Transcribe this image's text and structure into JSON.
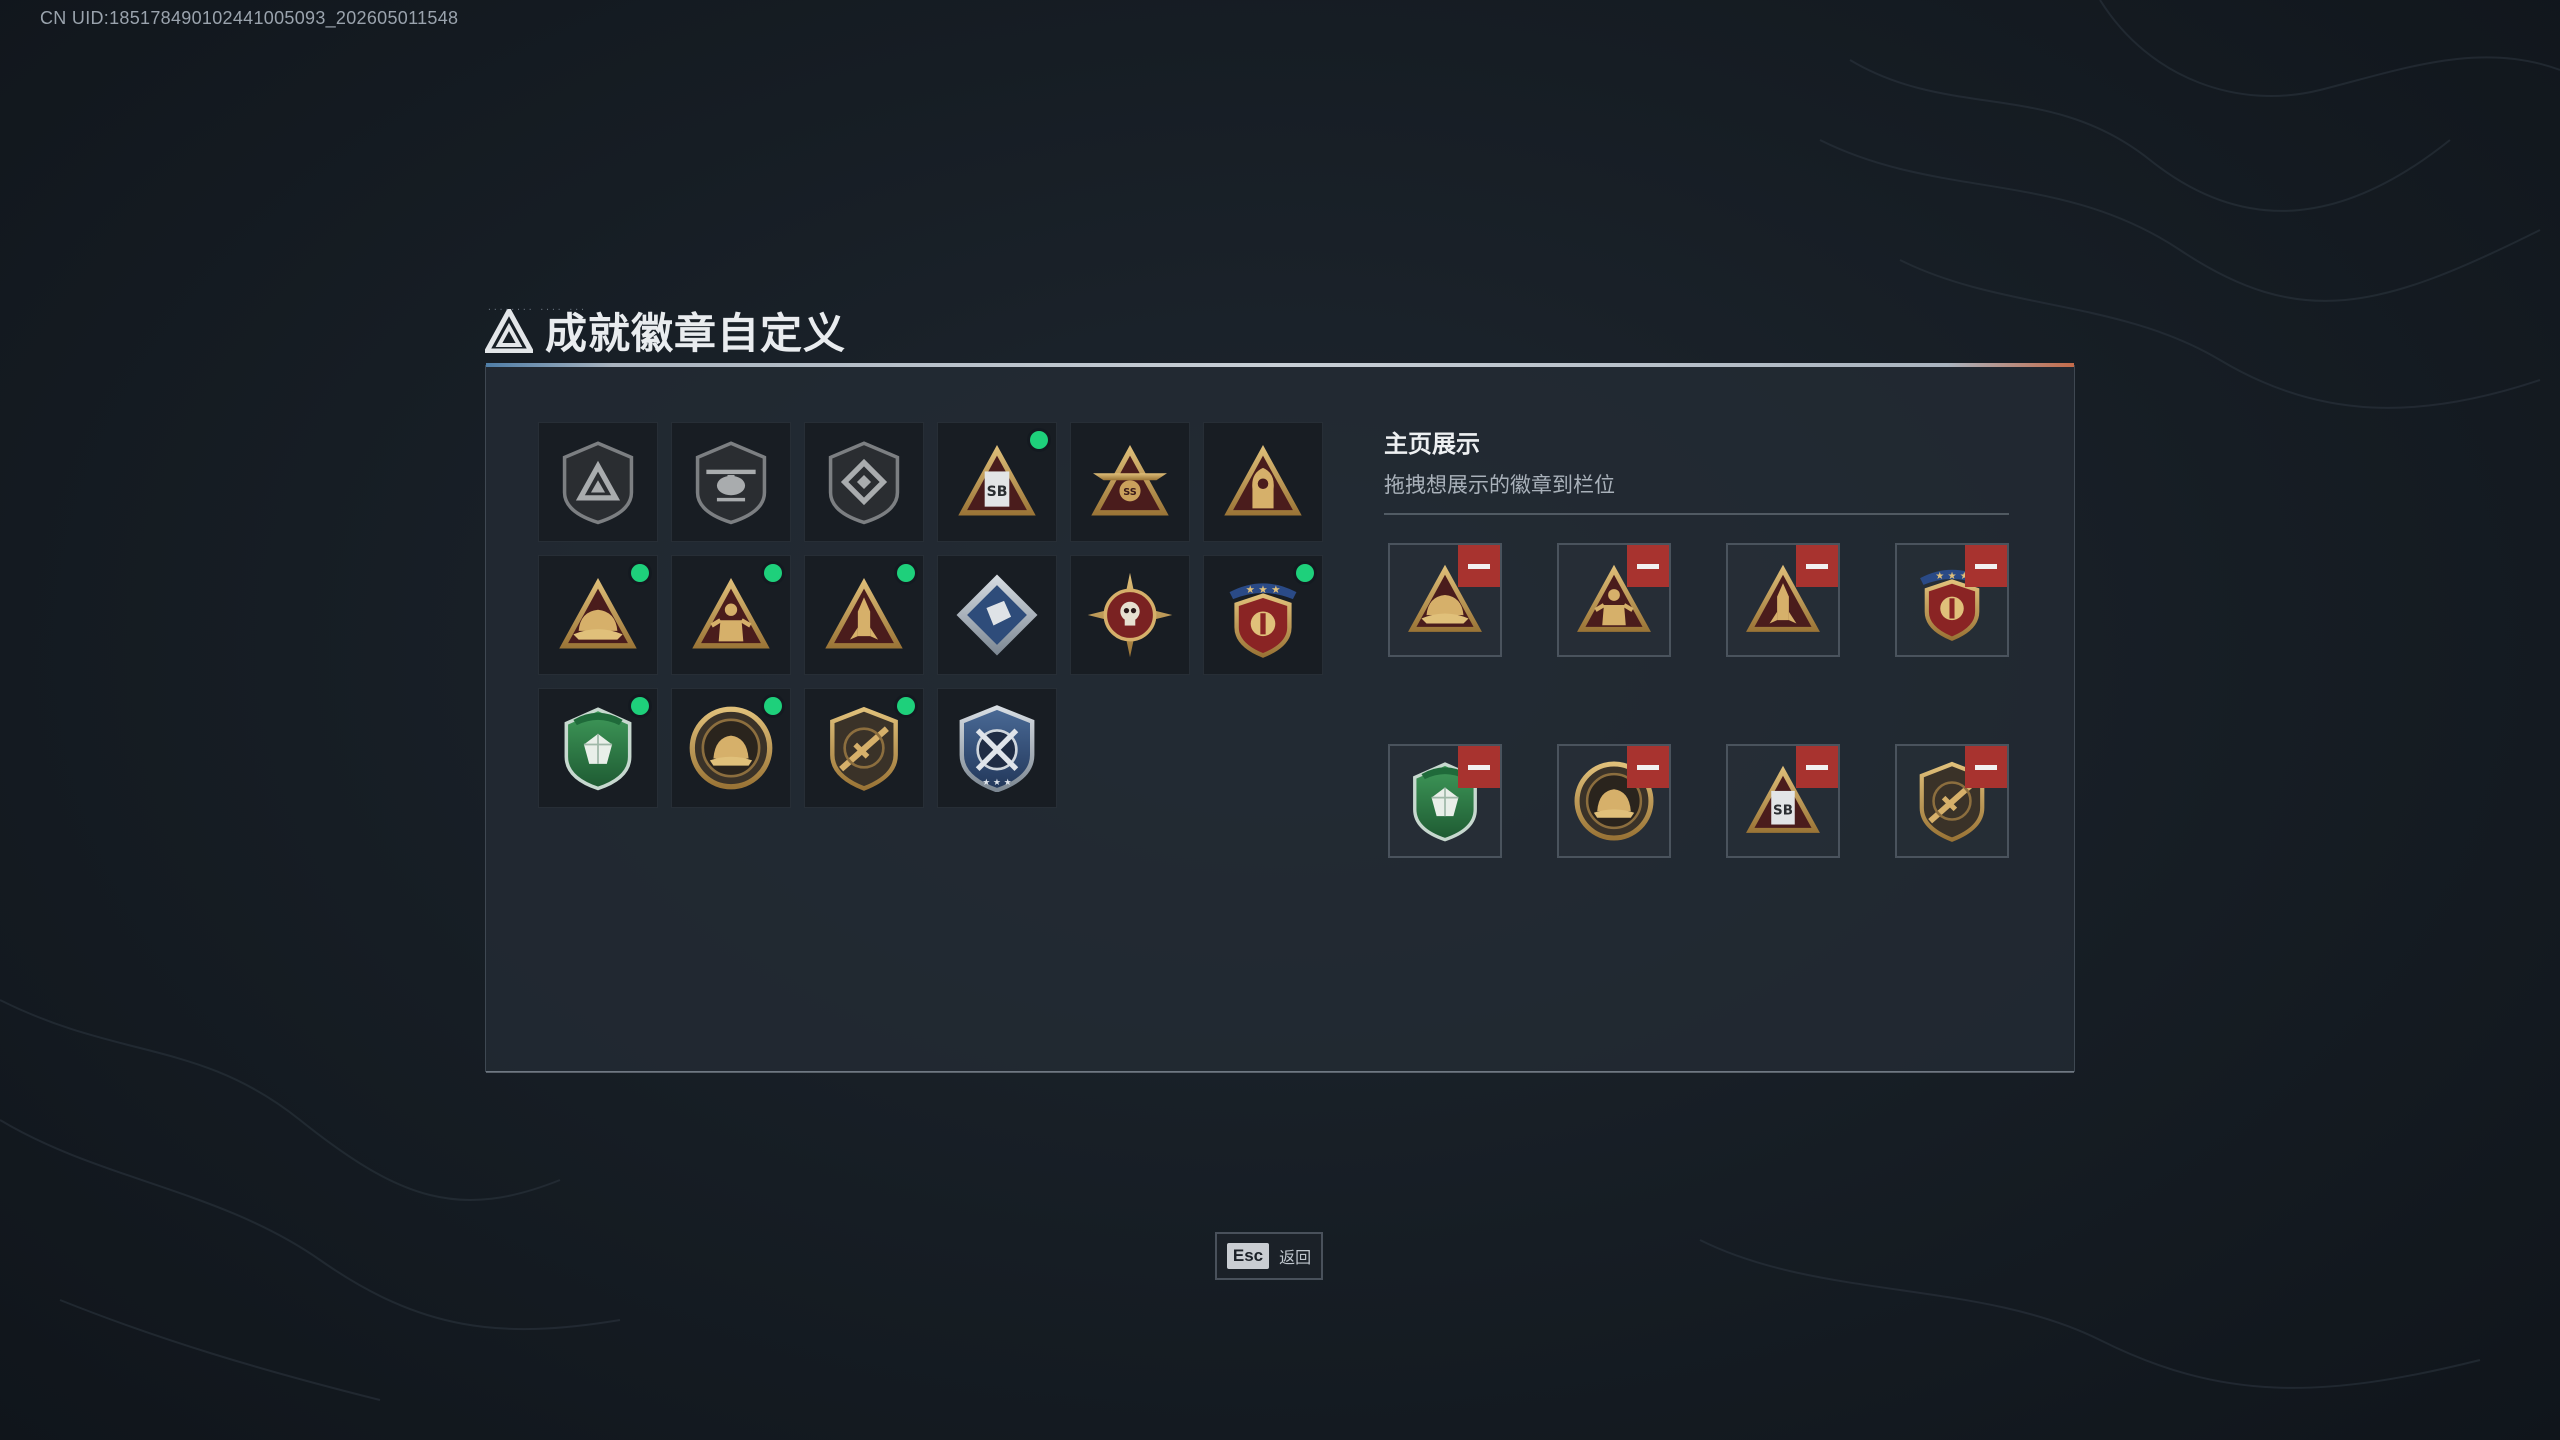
{
  "uid_text": "CN UID:18517849010244100509​3_202605011548",
  "header": {
    "title": "成就徽章自定义",
    "logo_icon": "triangle-logo-icon"
  },
  "badges": [
    {
      "icon": "shield-triangle-badge-icon",
      "new": false
    },
    {
      "icon": "helicopter-shield-badge-icon",
      "new": false
    },
    {
      "icon": "diamond-shield-badge-icon",
      "new": false
    },
    {
      "icon": "sb-building-triangle-badge-icon",
      "new": true
    },
    {
      "icon": "ss-winged-triangle-badge-icon",
      "new": false
    },
    {
      "icon": "hooded-figure-triangle-badge-icon",
      "new": false
    },
    {
      "icon": "helmet-triangle-badge-icon",
      "new": true
    },
    {
      "icon": "soldier-triangle-badge-icon",
      "new": true
    },
    {
      "icon": "rocket-triangle-badge-icon",
      "new": true
    },
    {
      "icon": "silver-diamond-badge-icon",
      "new": false
    },
    {
      "icon": "skull-star-compass-badge-icon",
      "new": false
    },
    {
      "icon": "red-star-crest-badge-icon",
      "new": true
    },
    {
      "icon": "green-gem-shield-badge-icon",
      "new": true
    },
    {
      "icon": "helmet-round-badge-icon",
      "new": true
    },
    {
      "icon": "rifle-shield-badge-icon",
      "new": true
    },
    {
      "icon": "blue-crossed-rifles-badge-icon",
      "new": false
    }
  ],
  "display": {
    "title": "主页展示",
    "subtitle": "拖拽想展示的徽章到栏位",
    "slots": [
      {
        "icon": "helmet-triangle-badge-icon"
      },
      {
        "icon": "soldier-triangle-badge-icon"
      },
      {
        "icon": "rocket-triangle-badge-icon"
      },
      {
        "icon": "red-star-crest-badge-icon"
      },
      {
        "icon": "green-gem-shield-badge-icon"
      },
      {
        "icon": "helmet-round-badge-icon"
      },
      {
        "icon": "sb-building-triangle-badge-icon"
      },
      {
        "icon": "rifle-shield-badge-icon"
      }
    ]
  },
  "footer": {
    "esc_key": "Esc",
    "esc_label": "返回"
  },
  "colors": {
    "new_dot": "#1ed07b",
    "remove": "#a8332f",
    "gold": "#c9a05a",
    "dark_red": "#5a1f1f"
  }
}
